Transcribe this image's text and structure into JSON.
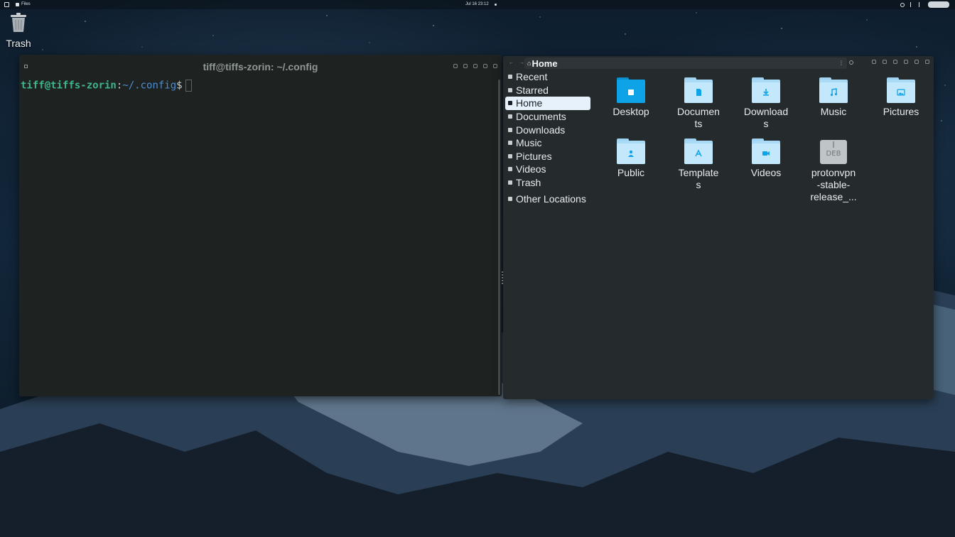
{
  "topbar": {
    "app_name": "Files",
    "clock": "Jul 16  23:12"
  },
  "desktop": {
    "trash_label": "Trash"
  },
  "terminal": {
    "title": "tiff@tiffs-zorin: ~/.config",
    "prompt_user": "tiff@tiffs-zorin",
    "prompt_sep": ":",
    "prompt_path": "~/.config",
    "prompt_symbol": "$"
  },
  "files": {
    "current_folder": "Home",
    "sidebar": [
      {
        "label": "Recent",
        "icon": "clock-icon"
      },
      {
        "label": "Starred",
        "icon": "star-icon"
      },
      {
        "label": "Home",
        "icon": "home-icon",
        "active": true
      },
      {
        "label": "Documents",
        "icon": "document-icon"
      },
      {
        "label": "Downloads",
        "icon": "download-icon"
      },
      {
        "label": "Music",
        "icon": "music-icon"
      },
      {
        "label": "Pictures",
        "icon": "picture-icon"
      },
      {
        "label": "Videos",
        "icon": "video-icon"
      },
      {
        "label": "Trash",
        "icon": "trash-icon"
      },
      {
        "label": "Other Locations",
        "icon": "plus-icon"
      }
    ],
    "items": [
      {
        "name": "Desktop",
        "line1": "Desktop",
        "line2": "",
        "line3": "",
        "type": "folder"
      },
      {
        "name": "Documents",
        "line1": "Documen",
        "line2": "ts",
        "line3": "",
        "type": "folder"
      },
      {
        "name": "Downloads",
        "line1": "Download",
        "line2": "s",
        "line3": "",
        "type": "folder"
      },
      {
        "name": "Music",
        "line1": "Music",
        "line2": "",
        "line3": "",
        "type": "folder"
      },
      {
        "name": "Pictures",
        "line1": "Pictures",
        "line2": "",
        "line3": "",
        "type": "folder"
      },
      {
        "name": "Public",
        "line1": "Public",
        "line2": "",
        "line3": "",
        "type": "folder"
      },
      {
        "name": "Templates",
        "line1": "Template",
        "line2": "s",
        "line3": "",
        "type": "folder"
      },
      {
        "name": "Videos",
        "line1": "Videos",
        "line2": "",
        "line3": "",
        "type": "folder"
      },
      {
        "name": "protonvpn-stable-release_...",
        "line1": "protonvpn",
        "line2": "-stable-",
        "line3": "release_...",
        "type": "deb",
        "badge": "DEB"
      }
    ]
  },
  "colors": {
    "terminal_bg": "#1e2322",
    "files_bg": "#252a2d",
    "prompt_user": "#3fb58a",
    "prompt_path": "#4c8ed1",
    "folder": "#c3e7fb",
    "desktop_folder": "#0ea3e6",
    "sidebar_active": "#e6f1fb"
  }
}
